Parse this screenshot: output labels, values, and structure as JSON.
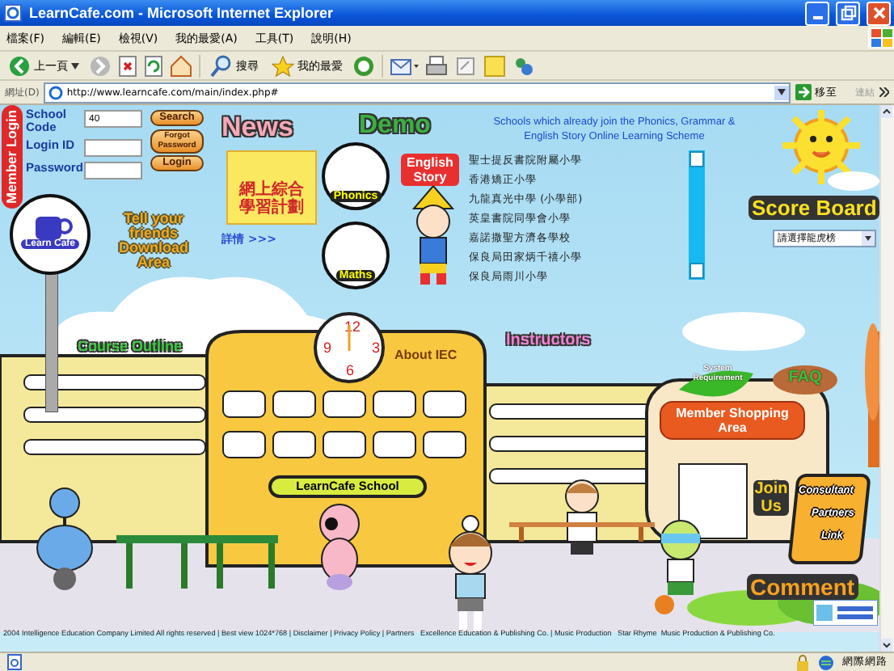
{
  "window": {
    "title": "LearnCafe.com - Microsoft Internet Explorer"
  },
  "menu_bar": [
    "檔案(F)",
    "編輯(E)",
    "檢視(V)",
    "我的最愛(A)",
    "工具(T)",
    "說明(H)"
  ],
  "toolbar": [
    {
      "label": "上一頁"
    },
    {
      "label": "搜尋"
    },
    {
      "label": "我的最愛"
    }
  ],
  "address_bar": {
    "label": "網址(D)",
    "url": "http://www.learncafe.com/main/index.php#",
    "go": "移至",
    "links": "連結"
  },
  "site": {
    "member_login": {
      "title": "Member Login",
      "fields": [
        {
          "label": "School Code",
          "value": "40"
        },
        {
          "label": "Login ID"
        },
        {
          "label": "Password"
        }
      ],
      "buttons": [
        "Search",
        "Forgot Password",
        "Login"
      ]
    },
    "logo": "Learn Cafe",
    "download": "Tell your friends Download Area",
    "news": {
      "title": "News",
      "banner": "網上綜合學習計劃",
      "more": "詳情 >>>"
    },
    "demo": {
      "title": "Demo",
      "items": [
        "Phonics",
        "Maths"
      ],
      "story": "English Story"
    },
    "schools": {
      "heading": "Schools which already join the Phonics, Grammar & English Story Online Learning Scheme",
      "items": [
        "聖士提反書院附屬小學",
        "香港矯正小學",
        "九龍真光中學 (小學部)",
        "英皇書院同學會小學",
        "嘉諾撒聖方濟各學校",
        "保良局田家炳千禧小學",
        "保良局雨川小學"
      ]
    },
    "score_board": {
      "title": "Score Board",
      "select": "請選擇龍虎榜"
    },
    "course_outline": "Course Outline",
    "clock": [
      "12",
      "3",
      "6",
      "9"
    ],
    "about": "About IEC",
    "instructors": "Instructors",
    "system_requirement": "System Requirement",
    "faq": "FAQ",
    "shopping": "Member Shopping Area",
    "join_us": "Join Us",
    "join_links": [
      "Consultant",
      "Partners",
      "Link"
    ],
    "school_sign": "LearnCafe School",
    "comment": "Comment",
    "footer": "2004 Intelligence Education Company Limited All rights reserved | Best view 1024*768 | Disclaimer | Privacy Policy | Partners   Excellence Education & Publishing Co. | Music Production   Star Rhyme  Music Production & Publishing Co."
  },
  "status_bar": {
    "zone": "網際網路"
  }
}
